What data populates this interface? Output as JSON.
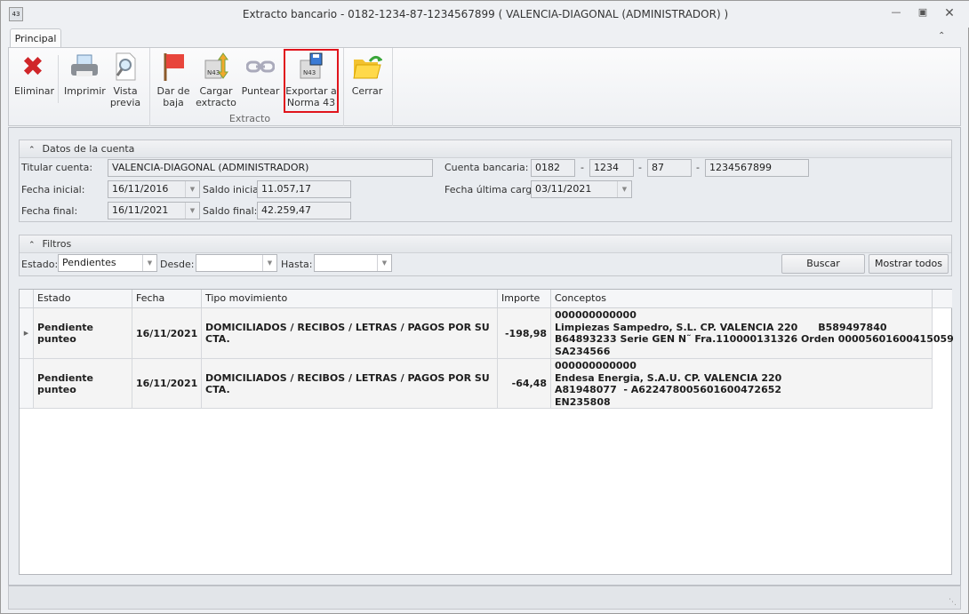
{
  "window": {
    "title": "Extracto bancario - 0182-1234-87-1234567899 ( VALENCIA-DIAGONAL (ADMINISTRADOR) )",
    "app_icon_text": "43"
  },
  "ribbon": {
    "tab": "Principal",
    "buttons": {
      "eliminar": "Eliminar",
      "imprimir": "Imprimir",
      "vista_previa": "Vista previa",
      "dar_de_baja": "Dar de baja",
      "cargar_extracto": "Cargar extracto",
      "puntear": "Puntear",
      "exportar": "Exportar a Norma 43",
      "cerrar": "Cerrar"
    },
    "group_label": "Extracto",
    "icon_badge": "N43"
  },
  "cuenta": {
    "header": "Datos de la cuenta",
    "titular_label": "Titular cuenta:",
    "titular": "VALENCIA-DIAGONAL (ADMINISTRADOR)",
    "fecha_inicial_label": "Fecha inicial:",
    "fecha_inicial": "16/11/2016",
    "saldo_inicial_label": "Saldo inicial:",
    "saldo_inicial": "11.057,17",
    "fecha_final_label": "Fecha final:",
    "fecha_final": "16/11/2021",
    "saldo_final_label": "Saldo final:",
    "saldo_final": "42.259,47",
    "cuenta_label": "Cuenta bancaria:",
    "entidad": "0182",
    "oficina": "1234",
    "dc": "87",
    "numero": "1234567899",
    "dash": "-",
    "ultima_carga_label": "Fecha última carga:",
    "ultima_carga": "03/11/2021"
  },
  "filtros": {
    "header": "Filtros",
    "estado_label": "Estado:",
    "estado": "Pendientes",
    "desde_label": "Desde:",
    "desde": "",
    "hasta_label": "Hasta:",
    "hasta": "",
    "buscar": "Buscar",
    "mostrar_todos": "Mostrar todos"
  },
  "grid": {
    "columns": [
      "Estado",
      "Fecha",
      "Tipo movimiento",
      "Importe",
      "Conceptos"
    ],
    "rows": [
      {
        "estado": "Pendiente punteo",
        "fecha": "16/11/2021",
        "tipo": "DOMICILIADOS / RECIBOS / LETRAS / PAGOS POR SU CTA.",
        "importe": "-198,98",
        "conceptos": [
          "000000000000",
          "Limpiezas Sampedro, S.L. CP. VALENCIA 220      B589497840",
          "B64893233 Serie GEN N˜ Fra.110000131326 Orden 00005601600415059",
          "SA234566"
        ]
      },
      {
        "estado": "Pendiente punteo",
        "fecha": "16/11/2021",
        "tipo": "DOMICILIADOS / RECIBOS / LETRAS / PAGOS POR SU CTA.",
        "importe": "-64,48",
        "conceptos": [
          "000000000000",
          "Endesa Energia, S.A.U. CP. VALENCIA 220",
          "A81948077  - A622478005601600472652",
          "EN235808"
        ]
      }
    ]
  }
}
